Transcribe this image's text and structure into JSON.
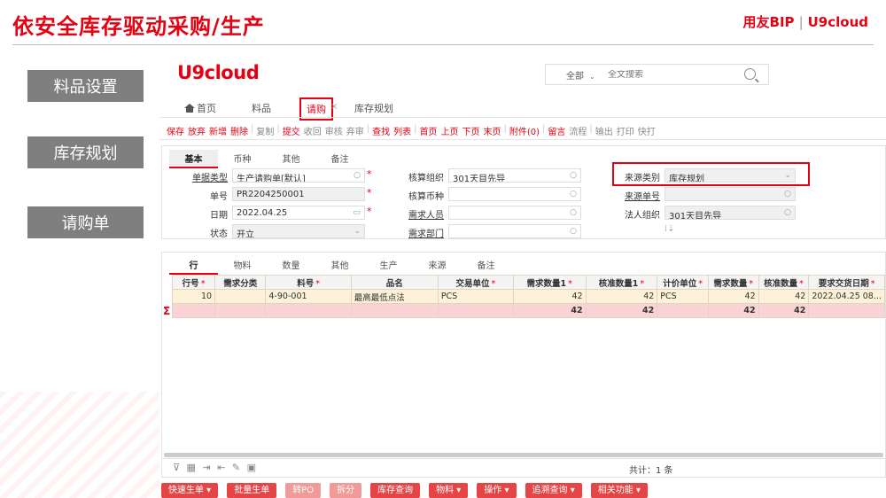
{
  "slide": {
    "title": "依安全库存驱动采购/生产",
    "brand_bip": "用友BIP",
    "brand_sep": "|",
    "brand_u9": "U9cloud"
  },
  "left_menu": [
    "料品设置",
    "库存规划",
    "请购单"
  ],
  "app": {
    "logo": "U9cloud",
    "search": {
      "scope": "全部",
      "placeholder": "全文搜索"
    },
    "tabs": {
      "home": "首页",
      "item": "料品",
      "requisition": "请购",
      "close": "×",
      "inventory_plan": "库存规划"
    },
    "toolbar": [
      "保存",
      "放弃",
      "新增",
      "删除",
      "复制",
      "提交",
      "收回",
      "审核",
      "弃审",
      "查找",
      "列表",
      "首页",
      "上页",
      "下页",
      "末页",
      "附件(0)",
      "留言",
      "流程",
      "输出",
      "打印",
      "快打"
    ],
    "form_tabs": [
      "基本",
      "币种",
      "其他",
      "备注"
    ],
    "form": {
      "doc_type_label": "单据类型",
      "doc_type_value": "生产请购单[默认]",
      "doc_no_label": "单号",
      "doc_no_value": "PR2204250001",
      "date_label": "日期",
      "date_value": "2022.04.25",
      "status_label": "状态",
      "status_value": "开立",
      "acct_org_label": "核算组织",
      "acct_org_value": "301天目先导",
      "acct_currency_label": "核算币种",
      "acct_currency_value": "",
      "req_person_label": "需求人员",
      "req_person_value": "",
      "req_dept_label": "需求部门",
      "req_dept_value": "",
      "source_type_label": "来源类别",
      "source_type_value": "库存规划",
      "source_no_label": "来源单号",
      "source_no_value": "",
      "legal_org_label": "法人组织",
      "legal_org_value": "301天目先导"
    },
    "grid_tabs": [
      "行",
      "物料",
      "数量",
      "其他",
      "生产",
      "来源",
      "备注"
    ],
    "grid": {
      "columns": [
        {
          "label": "行号",
          "required": true
        },
        {
          "label": "需求分类",
          "required": false
        },
        {
          "label": "料号",
          "required": true
        },
        {
          "label": "品名",
          "required": false
        },
        {
          "label": "交易单位",
          "required": true
        },
        {
          "label": "需求数量1",
          "required": true
        },
        {
          "label": "核准数量1",
          "required": true
        },
        {
          "label": "计价单位",
          "required": true
        },
        {
          "label": "需求数量",
          "required": true
        },
        {
          "label": "核准数量",
          "required": true
        },
        {
          "label": "要求交货日期",
          "required": true
        }
      ],
      "rows": [
        [
          "10",
          "",
          "4-90-001",
          "最高最低点法",
          "PCS",
          "42",
          "42",
          "PCS",
          "42",
          "42",
          "2022.04.25 08..."
        ]
      ],
      "sum_symbol": "Σ",
      "sum_row": [
        "",
        "",
        "",
        "",
        "",
        "42",
        "42",
        "",
        "42",
        "42",
        ""
      ],
      "footer_count": "共计：1 条"
    },
    "bottom_buttons": [
      "快速生单 ▾",
      "批量生单",
      "转PO",
      "拆分",
      "库存查询",
      "物料 ▾",
      "操作 ▾",
      "追溯查询 ▾",
      "相关功能 ▾"
    ]
  }
}
